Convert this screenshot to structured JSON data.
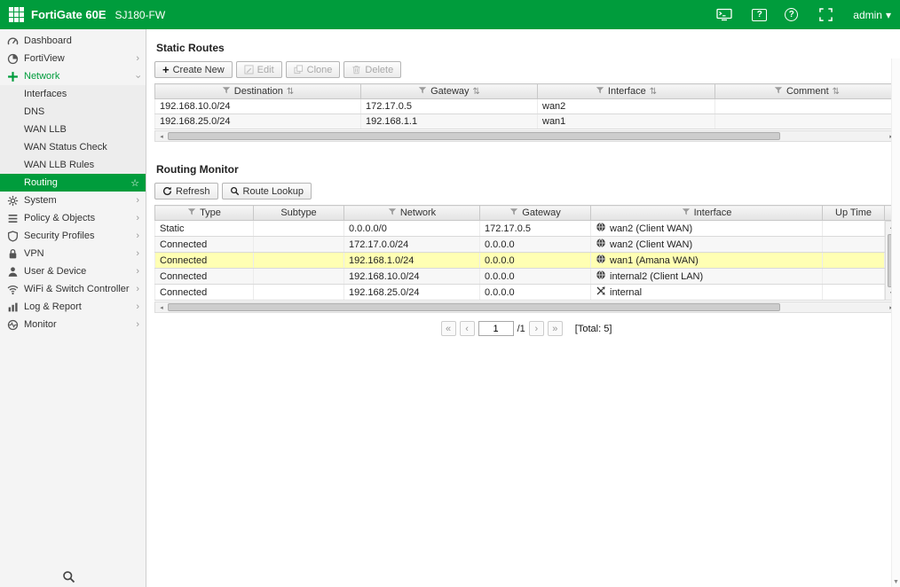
{
  "colors": {
    "brand_green": "#009c3c",
    "highlight_row": "#ffffb3"
  },
  "icons": {
    "plus": "+",
    "sort": "⇅",
    "caret_down": "▾",
    "chevron_right": "›",
    "star": "☆",
    "question": "?",
    "first": "«",
    "prev": "‹",
    "next": "›",
    "last": "»",
    "left": "◂",
    "right": "▸",
    "up": "▲",
    "down": "▼"
  },
  "topbar": {
    "brand": "FortiGate 60E",
    "hostname": "SJ180-FW",
    "user": "admin"
  },
  "sidebar": {
    "items": [
      {
        "label": "Dashboard"
      },
      {
        "label": "FortiView"
      },
      {
        "label": "Network"
      },
      {
        "label": "Interfaces"
      },
      {
        "label": "DNS"
      },
      {
        "label": "WAN LLB"
      },
      {
        "label": "WAN Status Check"
      },
      {
        "label": "WAN LLB Rules"
      },
      {
        "label": "Routing"
      },
      {
        "label": "System"
      },
      {
        "label": "Policy & Objects"
      },
      {
        "label": "Security Profiles"
      },
      {
        "label": "VPN"
      },
      {
        "label": "User & Device"
      },
      {
        "label": "WiFi & Switch Controller"
      },
      {
        "label": "Log & Report"
      },
      {
        "label": "Monitor"
      }
    ]
  },
  "static_routes": {
    "title": "Static Routes",
    "toolbar": {
      "create": "Create New",
      "edit": "Edit",
      "clone": "Clone",
      "delete": "Delete"
    },
    "columns": [
      "Destination",
      "Gateway",
      "Interface",
      "Comment"
    ],
    "rows": [
      {
        "destination": "192.168.10.0/24",
        "gateway": "172.17.0.5",
        "interface": "wan2",
        "comment": ""
      },
      {
        "destination": "192.168.25.0/24",
        "gateway": "192.168.1.1",
        "interface": "wan1",
        "comment": ""
      }
    ]
  },
  "routing_monitor": {
    "title": "Routing Monitor",
    "toolbar": {
      "refresh": "Refresh",
      "lookup": "Route Lookup"
    },
    "columns": [
      "Type",
      "Subtype",
      "Network",
      "Gateway",
      "Interface",
      "Up Time"
    ],
    "rows": [
      {
        "type": "Static",
        "subtype": "",
        "network": "0.0.0.0/0",
        "gateway": "172.17.0.5",
        "interface": "wan2 (Client WAN)",
        "uptime": ""
      },
      {
        "type": "Connected",
        "subtype": "",
        "network": "172.17.0.0/24",
        "gateway": "0.0.0.0",
        "interface": "wan2 (Client WAN)",
        "uptime": ""
      },
      {
        "type": "Connected",
        "subtype": "",
        "network": "192.168.1.0/24",
        "gateway": "0.0.0.0",
        "interface": "wan1 (Amana WAN)",
        "uptime": ""
      },
      {
        "type": "Connected",
        "subtype": "",
        "network": "192.168.10.0/24",
        "gateway": "0.0.0.0",
        "interface": "internal2 (Client LAN)",
        "uptime": ""
      },
      {
        "type": "Connected",
        "subtype": "",
        "network": "192.168.25.0/24",
        "gateway": "0.0.0.0",
        "interface": "internal",
        "uptime": ""
      }
    ],
    "pagination": {
      "page": "1",
      "of": "/1",
      "total": "[Total: 5]"
    }
  }
}
